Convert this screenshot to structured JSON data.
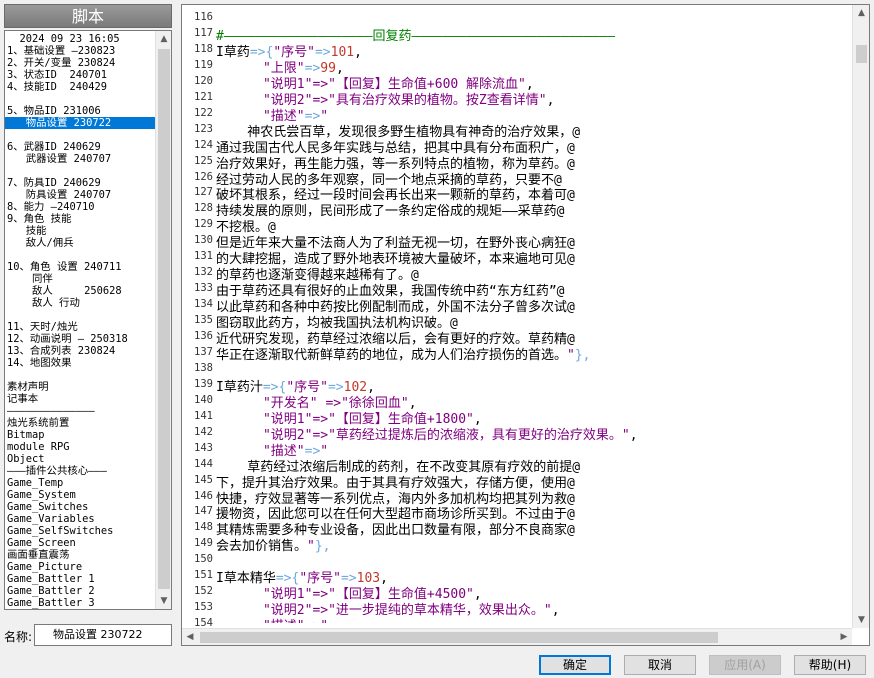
{
  "left_panel": {
    "title": "脚本",
    "items": [
      "  2024 09 23 16:05",
      "1、基础设置 —230823",
      "2、开关/变量 230824",
      "3、状态ID  240701",
      "4、技能ID  240429",
      "",
      "5、物品ID 231006",
      "   物品设置 230722",
      "",
      "6、武器ID 240629",
      "   武器设置 240707",
      "",
      "7、防具ID 240629",
      "   防具设置 240707",
      "8、能力 —240710",
      "9、角色 技能",
      "   技能",
      "   敌人/佣兵",
      "",
      "10、角色 设置 240711",
      "    同伴",
      "    敌人     250628",
      "    敌人 行动",
      "",
      "11、天时/烛光",
      "12、动画说明 — 250318",
      "13、合成列表 230824",
      "14、地图效果",
      "",
      "素材声明",
      "记事本",
      "——————————————",
      "烛光系统前置",
      "Bitmap",
      "module RPG",
      "Object",
      "———插件公共核心———",
      "Game_Temp",
      "Game_System",
      "Game_Switches",
      "Game_Variables",
      "Game_SelfSwitches",
      "Game_Screen",
      "画面垂直震荡",
      "Game_Picture",
      "Game_Battler 1",
      "Game_Battler 2",
      "Game_Battler 3"
    ],
    "selected_index": 7
  },
  "name_field": {
    "label": "名称:",
    "value": "物品设置 230722"
  },
  "editor": {
    "lines": [
      {
        "n": "116",
        "t": []
      },
      {
        "n": "117",
        "t": [
          [
            "cm",
            "#———————————————————回复药——————————————————————————"
          ]
        ]
      },
      {
        "n": "118",
        "t": [
          [
            "nm",
            "I草药"
          ],
          [
            "op",
            "=>{"
          ],
          [
            "st",
            "\"序号\""
          ],
          [
            "op",
            "=>"
          ],
          [
            "nu",
            "101"
          ],
          [
            "nm",
            ","
          ]
        ]
      },
      {
        "n": "119",
        "t": [
          [
            "nm",
            "      "
          ],
          [
            "st",
            "\"上限\""
          ],
          [
            "op",
            "=>"
          ],
          [
            "nu",
            "99"
          ],
          [
            "nm",
            ","
          ]
        ]
      },
      {
        "n": "120",
        "t": [
          [
            "nm",
            "      "
          ],
          [
            "st",
            "\"说明1\"=>\"【回复】生命值+600 解除流血\""
          ],
          [
            "nm",
            ","
          ]
        ]
      },
      {
        "n": "121",
        "t": [
          [
            "nm",
            "      "
          ],
          [
            "st",
            "\"说明2\"=>\"具有治疗效果的植物。按Z查看详情\""
          ],
          [
            "nm",
            ","
          ]
        ]
      },
      {
        "n": "122",
        "t": [
          [
            "nm",
            "      "
          ],
          [
            "st",
            "\"描述\""
          ],
          [
            "op",
            "=>"
          ],
          [
            "st",
            "\""
          ]
        ]
      },
      {
        "n": "123",
        "t": [
          [
            "nm",
            "    神农氏尝百草，发现很多野生植物具有神奇的治疗效果，@"
          ]
        ]
      },
      {
        "n": "124",
        "t": [
          [
            "nm",
            "通过我国古代人民多年实践与总结，把其中具有分布面积广，@"
          ]
        ]
      },
      {
        "n": "125",
        "t": [
          [
            "nm",
            "治疗效果好，再生能力强，等一系列特点的植物，称为草药。@"
          ]
        ]
      },
      {
        "n": "126",
        "t": [
          [
            "nm",
            "经过劳动人民的多年观察，同一个地点采摘的草药，只要不@"
          ]
        ]
      },
      {
        "n": "127",
        "t": [
          [
            "nm",
            "破坏其根系，经过一段时间会再长出来一颗新的草药，本着可@"
          ]
        ]
      },
      {
        "n": "128",
        "t": [
          [
            "nm",
            "持续发展的原则，民间形成了一条约定俗成的规矩——采草药@"
          ]
        ]
      },
      {
        "n": "129",
        "t": [
          [
            "nm",
            "不挖根。@"
          ]
        ]
      },
      {
        "n": "130",
        "t": [
          [
            "nm",
            "但是近年来大量不法商人为了利益无视一切，在野外丧心病狂@"
          ]
        ]
      },
      {
        "n": "131",
        "t": [
          [
            "nm",
            "的大肆挖掘，造成了野外地表环境被大量破坏，本来遍地可见@"
          ]
        ]
      },
      {
        "n": "132",
        "t": [
          [
            "nm",
            "的草药也逐渐变得越来越稀有了。@"
          ]
        ]
      },
      {
        "n": "133",
        "t": [
          [
            "nm",
            "由于草药还具有很好的止血效果，我国传统中药“东方红药”@"
          ]
        ]
      },
      {
        "n": "134",
        "t": [
          [
            "nm",
            "以此草药和各种中药按比例配制而成，外国不法分子曾多次试@"
          ]
        ]
      },
      {
        "n": "135",
        "t": [
          [
            "nm",
            "图窃取此药方，均被我国执法机构识破。@"
          ]
        ]
      },
      {
        "n": "136",
        "t": [
          [
            "nm",
            "近代研究发现，药草经过浓缩以后，会有更好的疗效。草药精@"
          ]
        ]
      },
      {
        "n": "137",
        "t": [
          [
            "nm",
            "华正在逐渐取代新鲜草药的地位，成为人们治疗损伤的首选。"
          ],
          [
            "st",
            "\""
          ],
          [
            "op",
            "},"
          ]
        ]
      },
      {
        "n": "138",
        "t": []
      },
      {
        "n": "139",
        "t": [
          [
            "nm",
            "I草药汁"
          ],
          [
            "op",
            "=>{"
          ],
          [
            "st",
            "\"序号\""
          ],
          [
            "op",
            "=>"
          ],
          [
            "nu",
            "102"
          ],
          [
            "nm",
            ","
          ]
        ]
      },
      {
        "n": "140",
        "t": [
          [
            "nm",
            "      "
          ],
          [
            "st",
            "\"开发名\" =>\"徐徐回血\""
          ],
          [
            "nm",
            ","
          ]
        ]
      },
      {
        "n": "141",
        "t": [
          [
            "nm",
            "      "
          ],
          [
            "st",
            "\"说明1\"=>\"【回复】生命值+1800\""
          ],
          [
            "nm",
            ","
          ]
        ]
      },
      {
        "n": "142",
        "t": [
          [
            "nm",
            "      "
          ],
          [
            "st",
            "\"说明2\"=>\"草药经过提炼后的浓缩液，具有更好的治疗效果。\""
          ],
          [
            "nm",
            ","
          ]
        ]
      },
      {
        "n": "143",
        "t": [
          [
            "nm",
            "      "
          ],
          [
            "st",
            "\"描述\""
          ],
          [
            "op",
            "=>"
          ],
          [
            "st",
            "\""
          ]
        ]
      },
      {
        "n": "144",
        "t": [
          [
            "nm",
            "    草药经过浓缩后制成的药剂，在不改变其原有疗效的前提@"
          ]
        ]
      },
      {
        "n": "145",
        "t": [
          [
            "nm",
            "下，提升其治疗效果。由于其具有疗效强大，存储方便，使用@"
          ]
        ]
      },
      {
        "n": "146",
        "t": [
          [
            "nm",
            "快捷，疗效显著等一系列优点，海内外多加机构均把其列为救@"
          ]
        ]
      },
      {
        "n": "147",
        "t": [
          [
            "nm",
            "援物资，因此您可以在任何大型超市商场诊所买到。不过由于@"
          ]
        ]
      },
      {
        "n": "148",
        "t": [
          [
            "nm",
            "其精炼需要多种专业设备，因此出口数量有限，部分不良商家@"
          ]
        ]
      },
      {
        "n": "149",
        "t": [
          [
            "nm",
            "会去加价销售。"
          ],
          [
            "st",
            "\""
          ],
          [
            "op",
            "},"
          ]
        ]
      },
      {
        "n": "150",
        "t": []
      },
      {
        "n": "151",
        "t": [
          [
            "nm",
            "I草本精华"
          ],
          [
            "op",
            "=>{"
          ],
          [
            "st",
            "\"序号\""
          ],
          [
            "op",
            "=>"
          ],
          [
            "nu",
            "103"
          ],
          [
            "nm",
            ","
          ]
        ]
      },
      {
        "n": "152",
        "t": [
          [
            "nm",
            "      "
          ],
          [
            "st",
            "\"说明1\"=>\"【回复】生命值+4500\""
          ],
          [
            "nm",
            ","
          ]
        ]
      },
      {
        "n": "153",
        "t": [
          [
            "nm",
            "      "
          ],
          [
            "st",
            "\"说明2\"=>\"进一步提纯的草本精华，效果出众。\""
          ],
          [
            "nm",
            ","
          ]
        ]
      },
      {
        "n": "154",
        "t": [
          [
            "nm",
            "      "
          ],
          [
            "st",
            "\"描述\""
          ],
          [
            "op",
            "=>"
          ],
          [
            "st",
            "\""
          ]
        ]
      }
    ]
  },
  "buttons": {
    "ok": "确定",
    "cancel": "取消",
    "apply": "应用(A)",
    "help": "帮助(H)"
  },
  "icons": {
    "up": "▲",
    "down": "▼",
    "left": "◀",
    "right": "▶"
  }
}
